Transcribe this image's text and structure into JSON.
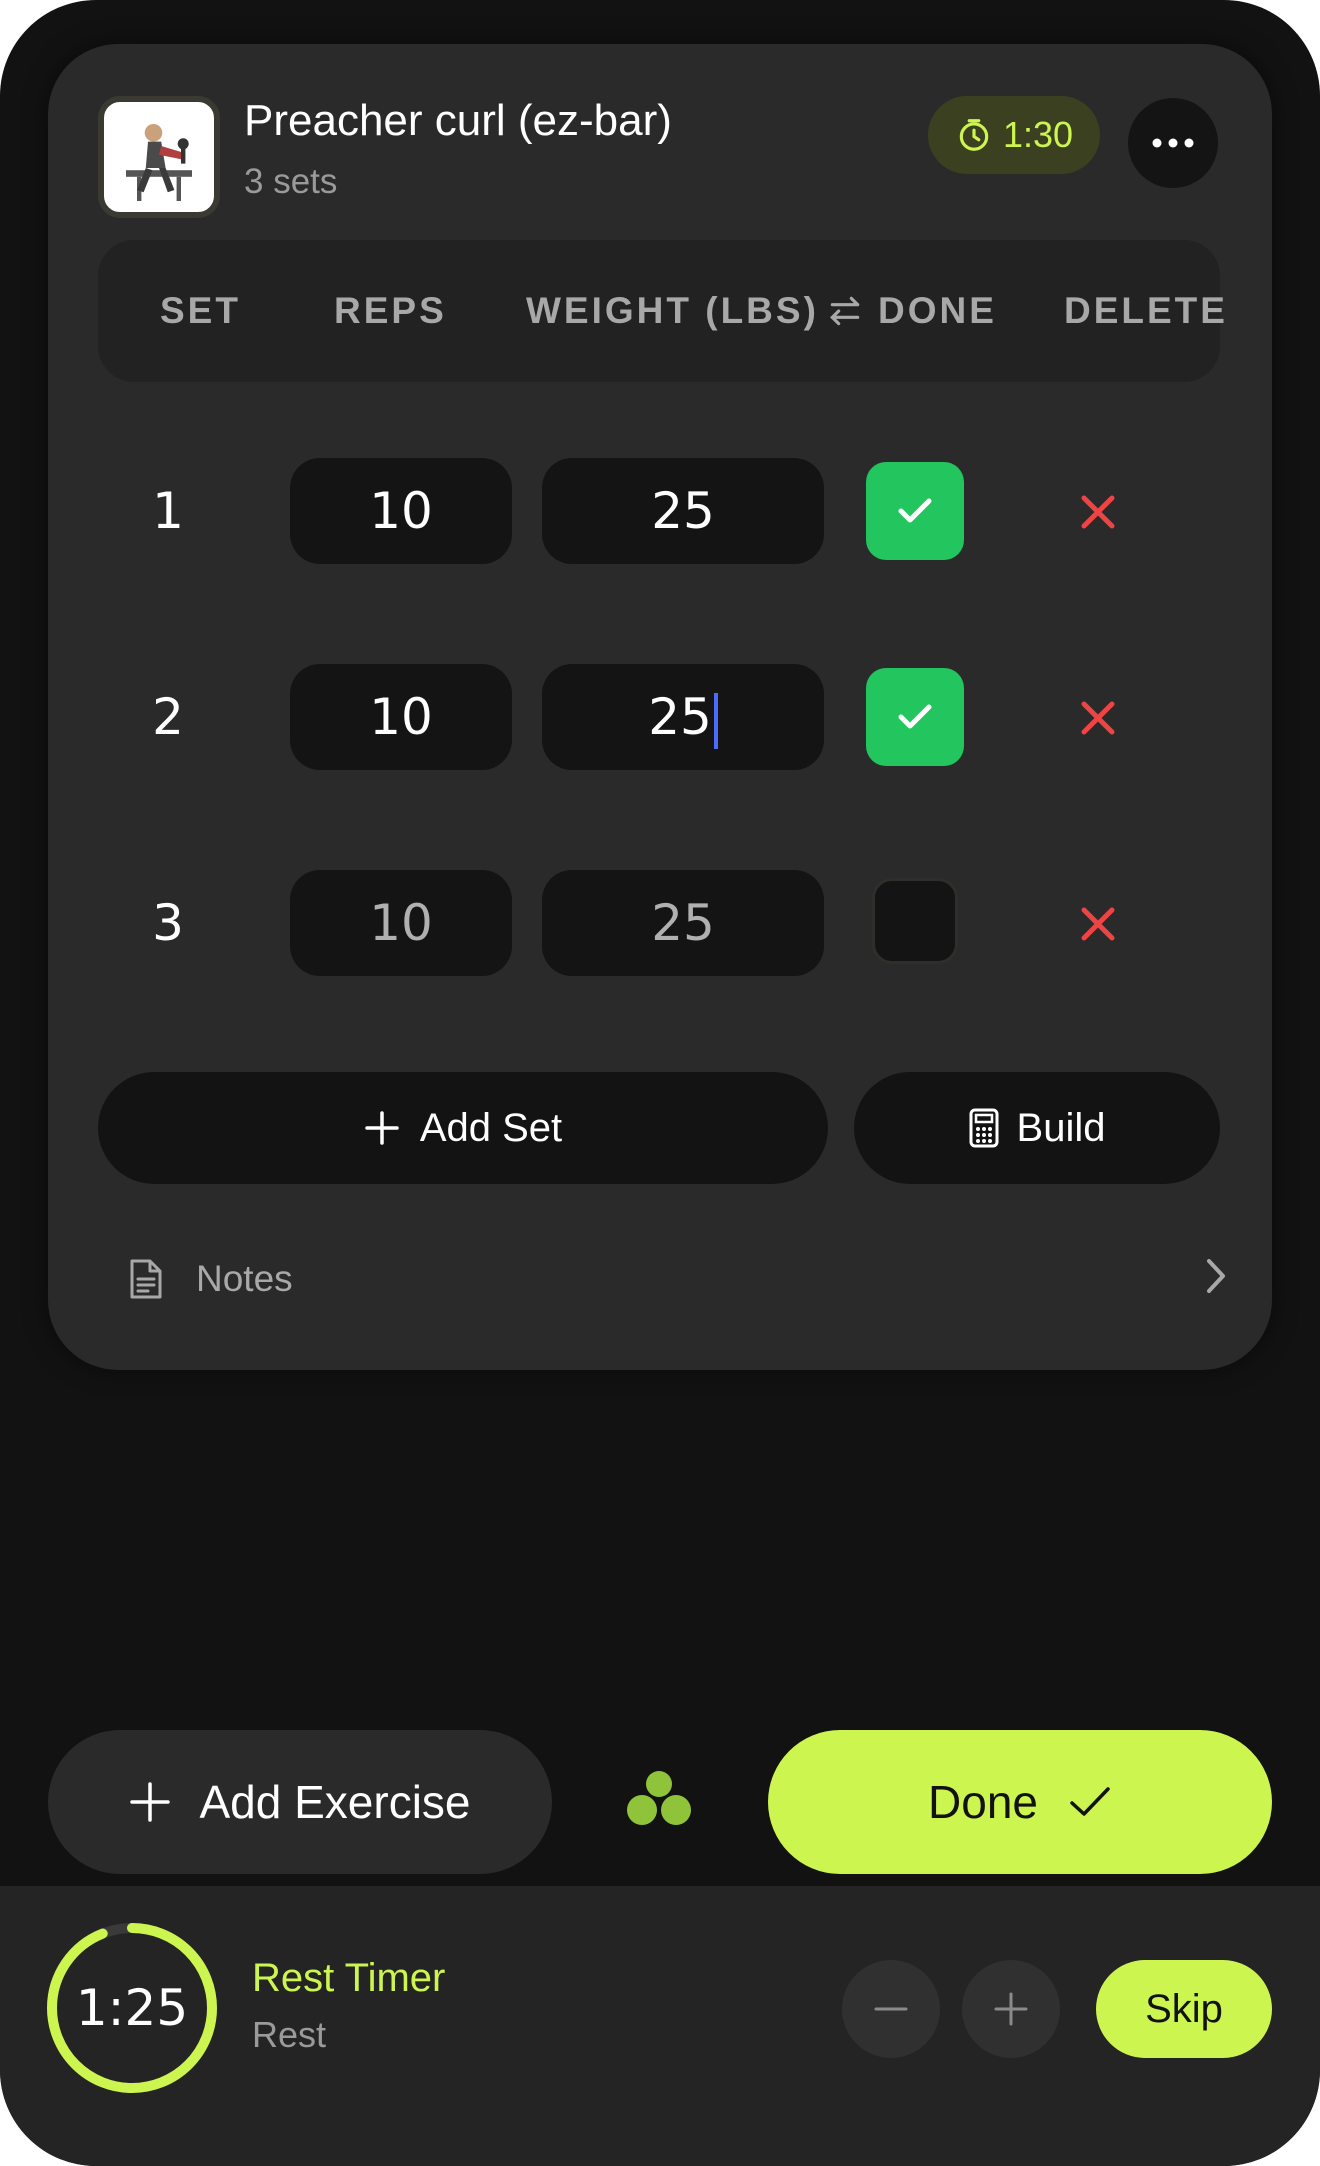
{
  "exercise": {
    "title": "Preacher curl (ez-bar)",
    "subtitle": "3 sets",
    "rest_time": "1:30",
    "thumbnail_icon": "exercise-illustration"
  },
  "table": {
    "headers": {
      "set": "SET",
      "reps": "REPS",
      "weight": "WEIGHT (LBS)",
      "done": "DONE",
      "delete": "DELETE"
    },
    "rows": [
      {
        "set": "1",
        "reps": "10",
        "weight": "25",
        "done": true
      },
      {
        "set": "2",
        "reps": "10",
        "weight": "25",
        "done": true
      },
      {
        "set": "3",
        "reps": "10",
        "weight": "25",
        "done": false
      }
    ]
  },
  "actions": {
    "add_set": "Add Set",
    "build": "Build"
  },
  "notes": {
    "label": "Notes"
  },
  "bottom": {
    "add_exercise": "Add Exercise",
    "done": "Done"
  },
  "rest_timer": {
    "time": "1:25",
    "title": "Rest Timer",
    "subtitle": "Rest",
    "skip": "Skip",
    "progress": 0.94
  },
  "colors": {
    "accent": "#cdf54f",
    "success": "#22c55e",
    "danger": "#ef4444",
    "background": "#121212",
    "card": "#2a2a2a"
  }
}
